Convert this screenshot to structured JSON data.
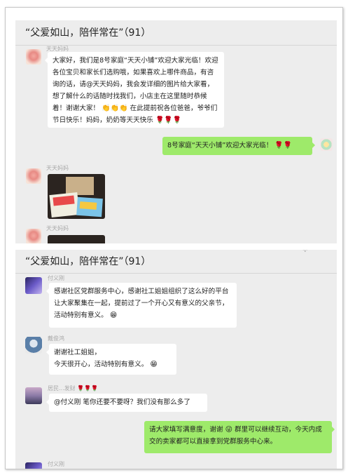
{
  "chat1": {
    "title": "“父爱如山，陪伴常在”（91）",
    "msg1": {
      "nick": "天天妈妈",
      "text": "大家好，我们是8号家庭“天天小铺”欢迎大家光临！欢迎各位宝贝和家长们选购哦，如果喜欢上哪件商品，有咨询的话，请@天天妈妈，我会发详细的图片给大家看，想了解什么的话随时找我们，小店主在这里随时恭候着！谢谢大家！",
      "text_tail": "在此提前祝各位爸爸，爷爷们节日快乐！妈妈，奶奶等天天快乐"
    },
    "msg2": {
      "text": "8号家庭“天天小铺”欢迎大家光临！"
    },
    "msg3": {
      "nick": "天天妈妈"
    },
    "msg4": {
      "nick": "天天妈妈"
    }
  },
  "chat2": {
    "title": "“父爱如山，陪伴常在”（91）",
    "msg1": {
      "nick": "付义刚",
      "text": "感谢社区党群服务中心，感谢社工姐姐组织了这么好的平台让大家聚集在一起，提前过了一个开心又有意义的父亲节，活动特别有意义。"
    },
    "msg2": {
      "nick": "戴俊鸿",
      "line1": "谢谢社工姐姐，",
      "line2": "今天很开心，活动特别有意义。"
    },
    "msg3": {
      "nick": "居民...发财",
      "text": "@付义刚 笔你还要不要呀？我们没有那么多了"
    },
    "msg4": {
      "text_a": "请大家填写满意度，谢谢",
      "text_b": "群里可以继续互动，今天内成交的卖家都可以直接拿到党群服务中心来。"
    },
    "msg5": {
      "nick": "付义刚"
    }
  },
  "colors": {
    "bubble_self": "#9eea6a",
    "bubble_other": "#ffffff",
    "background": "#ededed"
  }
}
